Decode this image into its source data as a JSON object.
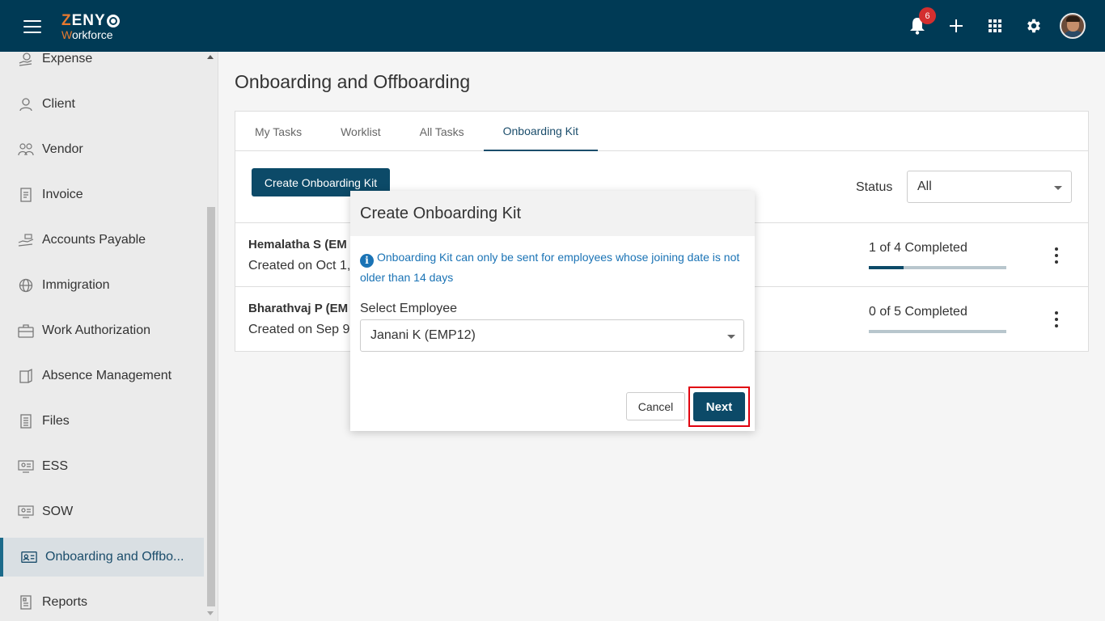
{
  "app": {
    "logo_top": "ZENY",
    "logo_bottom": "Workforce",
    "notification_count": "6"
  },
  "sidebar": {
    "items": [
      {
        "label": "Expense",
        "icon": "expense-icon"
      },
      {
        "label": "Client",
        "icon": "client-icon"
      },
      {
        "label": "Vendor",
        "icon": "vendor-icon"
      },
      {
        "label": "Invoice",
        "icon": "invoice-icon"
      },
      {
        "label": "Accounts Payable",
        "icon": "accounts-payable-icon"
      },
      {
        "label": "Immigration",
        "icon": "globe-icon"
      },
      {
        "label": "Work Authorization",
        "icon": "briefcase-icon"
      },
      {
        "label": "Absence Management",
        "icon": "absence-icon"
      },
      {
        "label": "Files",
        "icon": "files-icon"
      },
      {
        "label": "ESS",
        "icon": "ess-icon"
      },
      {
        "label": "SOW",
        "icon": "sow-icon"
      },
      {
        "label": "Onboarding and Offbo...",
        "icon": "id-card-icon",
        "active": true
      },
      {
        "label": "Reports",
        "icon": "reports-icon"
      }
    ]
  },
  "main": {
    "title": "Onboarding and Offboarding",
    "tabs": [
      "My Tasks",
      "Worklist",
      "All Tasks",
      "Onboarding Kit"
    ],
    "active_tab": "Onboarding Kit",
    "create_button": "Create Onboarding Kit",
    "status_label": "Status",
    "status_value": "All",
    "rows": [
      {
        "name": "Hemalatha S (EM",
        "created": "Created on Oct 1,",
        "progress_text": "1 of 4 Completed",
        "progress": 0.25
      },
      {
        "name": "Bharathvaj P (EM",
        "created": "Created on Sep 9,",
        "progress_text": "0 of 5 Completed",
        "progress": 0.0
      }
    ]
  },
  "modal": {
    "title": "Create Onboarding Kit",
    "info": "Onboarding Kit can only be sent for employees whose joining date is not older than 14 days",
    "select_label": "Select Employee",
    "selected_employee": "Janani K (EMP12)",
    "cancel_label": "Cancel",
    "next_label": "Next"
  },
  "colors": {
    "header": "#003a55",
    "primary": "#0c4a68",
    "accent": "#e8792f",
    "info": "#1a73b5",
    "highlight": "#e0000f"
  }
}
